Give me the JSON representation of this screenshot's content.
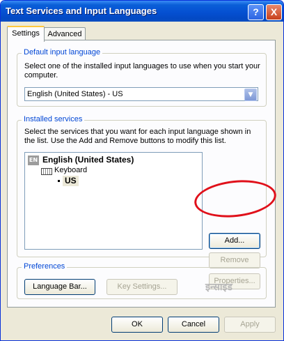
{
  "window": {
    "title": "Text Services and Input Languages"
  },
  "titlebar_buttons": {
    "help": "?",
    "close": "X"
  },
  "tabs": [
    {
      "label": "Settings",
      "active": true
    },
    {
      "label": "Advanced",
      "active": false
    }
  ],
  "default_language": {
    "legend": "Default input language",
    "description": "Select one of the installed input languages to use when you start your computer.",
    "selected": "English (United States) - US"
  },
  "installed_services": {
    "legend": "Installed services",
    "description": "Select the services that you want for each input language shown in the list. Use the Add and Remove buttons to modify this list.",
    "tree": {
      "badge": "EN",
      "language": "English (United States)",
      "category": "Keyboard",
      "layout": "US"
    },
    "buttons": {
      "add": "Add...",
      "remove": "Remove",
      "properties": "Properties..."
    }
  },
  "preferences": {
    "legend": "Preferences",
    "language_bar": "Language Bar...",
    "key_settings": "Key Settings..."
  },
  "watermark": "इन्साइड",
  "footer": {
    "ok": "OK",
    "cancel": "Cancel",
    "apply": "Apply"
  },
  "annotation_color": "#e0101a"
}
